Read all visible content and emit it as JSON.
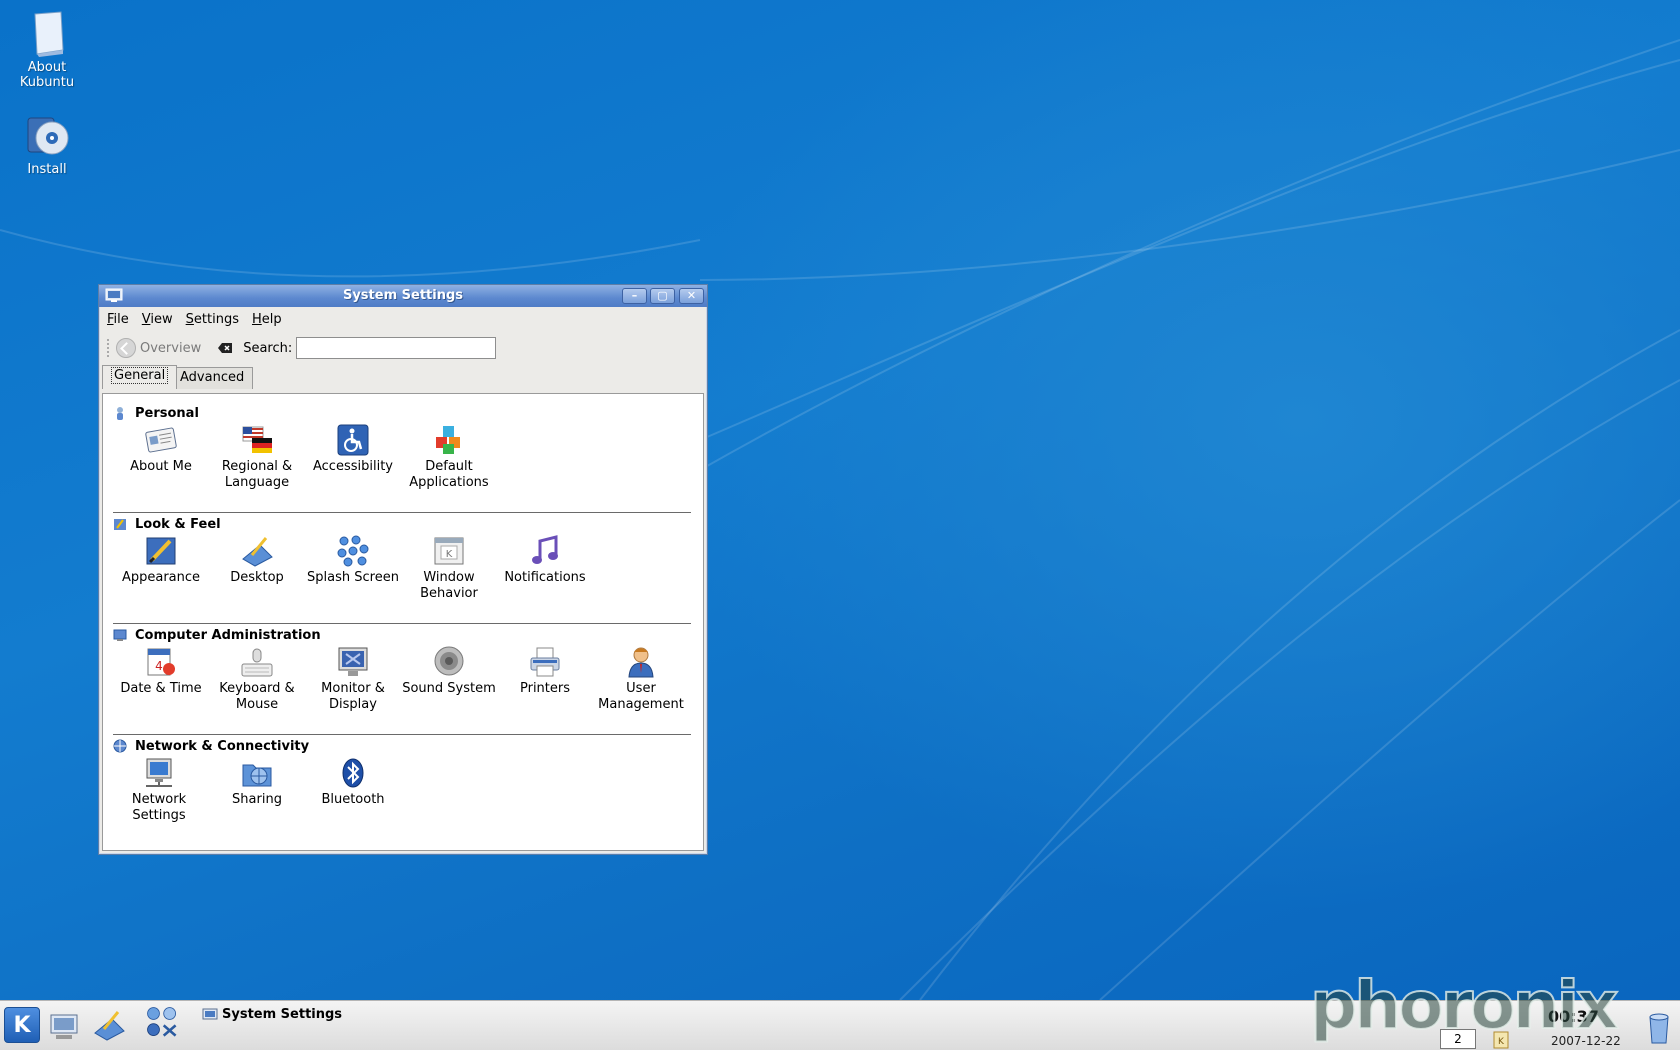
{
  "desktop": {
    "icons": [
      {
        "label": "About\nKubuntu",
        "icon": "document-icon"
      },
      {
        "label": "Install",
        "icon": "install-cd-icon"
      }
    ]
  },
  "window": {
    "title": "System Settings",
    "menu": [
      "File",
      "View",
      "Settings",
      "Help"
    ],
    "toolbar": {
      "back_label": "Overview",
      "search_label": "Search:",
      "search_value": "",
      "search_placeholder": ""
    },
    "tabs": [
      "General",
      "Advanced"
    ],
    "active_tab": "General",
    "sections": [
      {
        "title": "Personal",
        "items": [
          "About Me",
          "Regional &\nLanguage",
          "Accessibility",
          "Default\nApplications"
        ]
      },
      {
        "title": "Look & Feel",
        "items": [
          "Appearance",
          "Desktop",
          "Splash Screen",
          "Window\nBehavior",
          "Notifications"
        ]
      },
      {
        "title": "Computer Administration",
        "items": [
          "Date & Time",
          "Keyboard &\nMouse",
          "Monitor &\nDisplay",
          "Sound System",
          "Printers",
          "User\nManagement"
        ]
      },
      {
        "title": "Network & Connectivity",
        "items": [
          "Network\nSettings",
          "Sharing",
          "Bluetooth"
        ]
      }
    ]
  },
  "taskbar": {
    "task_title": "System Settings",
    "pager_desktop": "2",
    "clock": "00:37",
    "date": "2007-12-22"
  },
  "watermark": "phoronix",
  "colors": {
    "desktop_blue": "#0e72c8",
    "titlebar_blue": "#5c88cf",
    "window_bg": "#ecebe8"
  }
}
